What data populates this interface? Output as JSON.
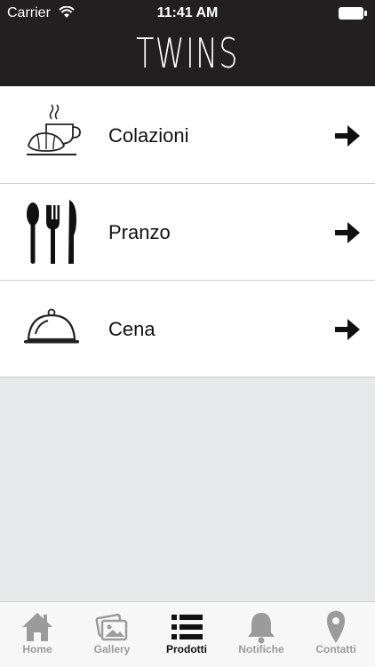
{
  "status_bar": {
    "carrier": "Carrier",
    "time": "11:41 AM"
  },
  "header": {
    "brand": "TWINS"
  },
  "menu": [
    {
      "label": "Colazioni",
      "icon": "coffee-croissant-icon"
    },
    {
      "label": "Pranzo",
      "icon": "cutlery-icon"
    },
    {
      "label": "Cena",
      "icon": "cloche-icon"
    }
  ],
  "tabbar": [
    {
      "label": "Home",
      "icon": "home-icon",
      "active": false
    },
    {
      "label": "Gallery",
      "icon": "gallery-icon",
      "active": false
    },
    {
      "label": "Prodotti",
      "icon": "list-icon",
      "active": true
    },
    {
      "label": "Notifiche",
      "icon": "bell-icon",
      "active": false
    },
    {
      "label": "Contatti",
      "icon": "location-pin-icon",
      "active": false
    }
  ],
  "colors": {
    "header_bg": "#231f20",
    "active_tab": "#111111",
    "inactive_tab": "#9b9b9b",
    "background": "#e6e9ea"
  }
}
